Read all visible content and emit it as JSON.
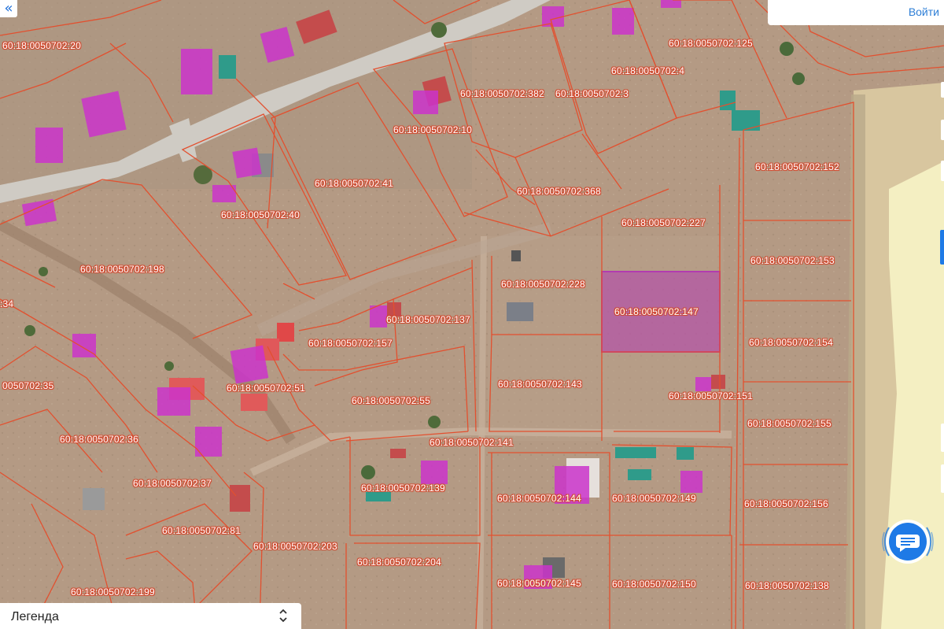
{
  "navigation": {
    "collapse_icon": "double-chevron-left-icon"
  },
  "header": {
    "login_label": "Войти"
  },
  "legend": {
    "label": "Легенда",
    "toggle_icon": "up-down-chevron-icon"
  },
  "chat": {
    "icon": "chat-bubble-icon",
    "accent_color": "#1e7ae6"
  },
  "map": {
    "boundary_color": "#e2502f",
    "building_color": "#cc33cc",
    "selected_parcel_color": "#b23bb0",
    "parcels": [
      {
        "number": "60:18:0050702:20"
      },
      {
        "number": "60:18:0050702:125"
      },
      {
        "number": "60:18:0050702:4"
      },
      {
        "number": "60:18:0050702:382"
      },
      {
        "number": "60:18:0050702:3"
      },
      {
        "number": "60:18:0050702:10"
      },
      {
        "number": "60:18:0050702:152"
      },
      {
        "number": "60:18:0050702:41"
      },
      {
        "number": "60:18:0050702:368"
      },
      {
        "number": "60:18:0050702:40"
      },
      {
        "number": "60:18:0050702:227"
      },
      {
        "number": "60:18:0050702:153"
      },
      {
        "number": "60:18:0050702:198"
      },
      {
        "number": "60:18:0050702:228"
      },
      {
        "number": "60:18:0050702:147",
        "selected": true
      },
      {
        "number": ":34"
      },
      {
        "number": "60:18:0050702:137"
      },
      {
        "number": "60:18:0050702:157"
      },
      {
        "number": "60:18:0050702:154"
      },
      {
        "number": "0050702:35"
      },
      {
        "number": "60:18:0050702:51"
      },
      {
        "number": "60:18:0050702:143"
      },
      {
        "number": "60:18:0050702:151"
      },
      {
        "number": "60:18:0050702:55"
      },
      {
        "number": "60:18:0050702:155"
      },
      {
        "number": "60:18:0050702:36"
      },
      {
        "number": "60:18:0050702:141"
      },
      {
        "number": "60:18:0050702:37"
      },
      {
        "number": "60:18:0050702:139"
      },
      {
        "number": "60:18:0050702:144"
      },
      {
        "number": "60:18:0050702:149"
      },
      {
        "number": "60:18:0050702:156"
      },
      {
        "number": "60:18:0050702:81"
      },
      {
        "number": "60:18:0050702:203"
      },
      {
        "number": "60:18:0050702:204"
      },
      {
        "number": "60:18:0050702:145"
      },
      {
        "number": "60:18:0050702:150"
      },
      {
        "number": "60:18:0050702:138"
      },
      {
        "number": "60:18:0050702:199"
      }
    ]
  }
}
